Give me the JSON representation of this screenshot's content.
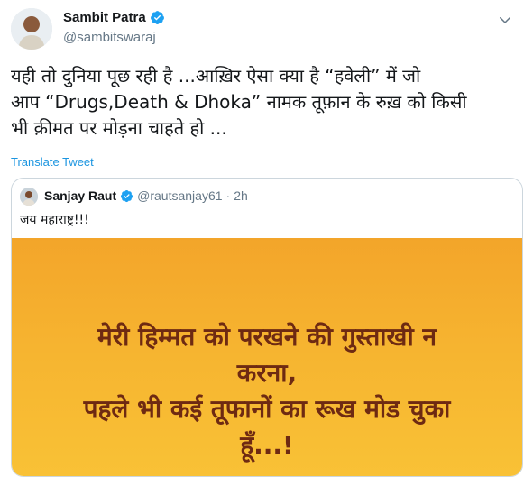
{
  "author": {
    "name": "Sambit Patra",
    "handle": "@sambitswaraj",
    "avatar_icon": "user-avatar-photo"
  },
  "tweet": {
    "lines": [
      "यही तो दुनिया पूछ रही है ...आख़िर ऐसा क्या है “हवेली” में जो",
      "आप “Drugs,Death & Dhoka” नामक तूफ़ान के रुख़ को किसी",
      "भी क़ीमत पर मोड़ना चाहते हो ..."
    ],
    "translate_label": "Translate Tweet"
  },
  "quoted_tweet": {
    "name": "Sanjay Raut",
    "handle": "@rautsanjay61",
    "separator": "·",
    "time": "2h",
    "text": "जय महाराष्ट्र!!!",
    "image_text": [
      "मेरी हिम्मत को परखने की गुस्ताखी न",
      "करना,",
      "पहले भी कई तूफानों का रूख मोड चुका",
      "हूँ...!"
    ]
  },
  "colors": {
    "accent": "#1da1f2",
    "link": "#1b95e0",
    "muted": "#657786",
    "image_bg": "#f6b430",
    "image_text": "#6e2a12"
  }
}
